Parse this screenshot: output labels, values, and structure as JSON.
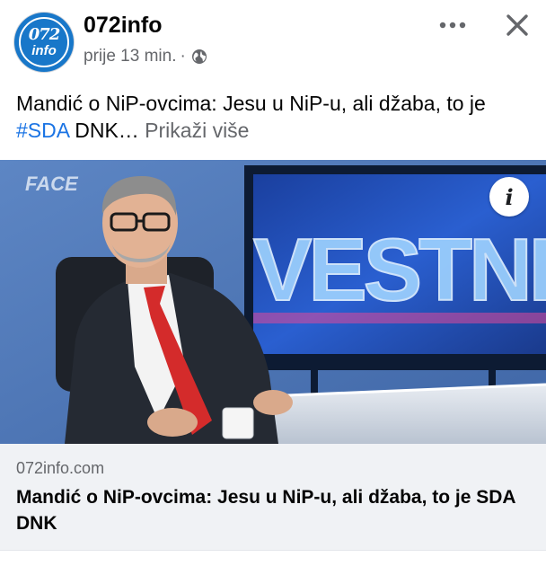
{
  "header": {
    "page_name": "072info",
    "time": "prije 13 min.",
    "separator": "·",
    "avatar": {
      "top_text": "072",
      "bottom_text": "info"
    },
    "privacy_icon": "globe-icon",
    "more_icon": "more-horizontal-icon",
    "close_icon": "close-icon"
  },
  "post": {
    "text_part1": "Mandić o NiP-ovcima: Jesu u NiP-u, ali džaba, to je ",
    "hashtag": "#SDA",
    "text_part2": " DNK… ",
    "see_more": "Prikaži više"
  },
  "image": {
    "watermark": "FACE",
    "screen_text": "VESTNI",
    "info_label": "i"
  },
  "link": {
    "domain": "072info.com",
    "title": "Mandić o NiP-ovcima: Jesu u NiP-u, ali džaba, to je SDA DNK"
  },
  "colors": {
    "brand_blue": "#1877c9",
    "hashtag": "#1b74e4",
    "meta_gray": "#65676b",
    "link_bg": "#f0f2f5"
  }
}
